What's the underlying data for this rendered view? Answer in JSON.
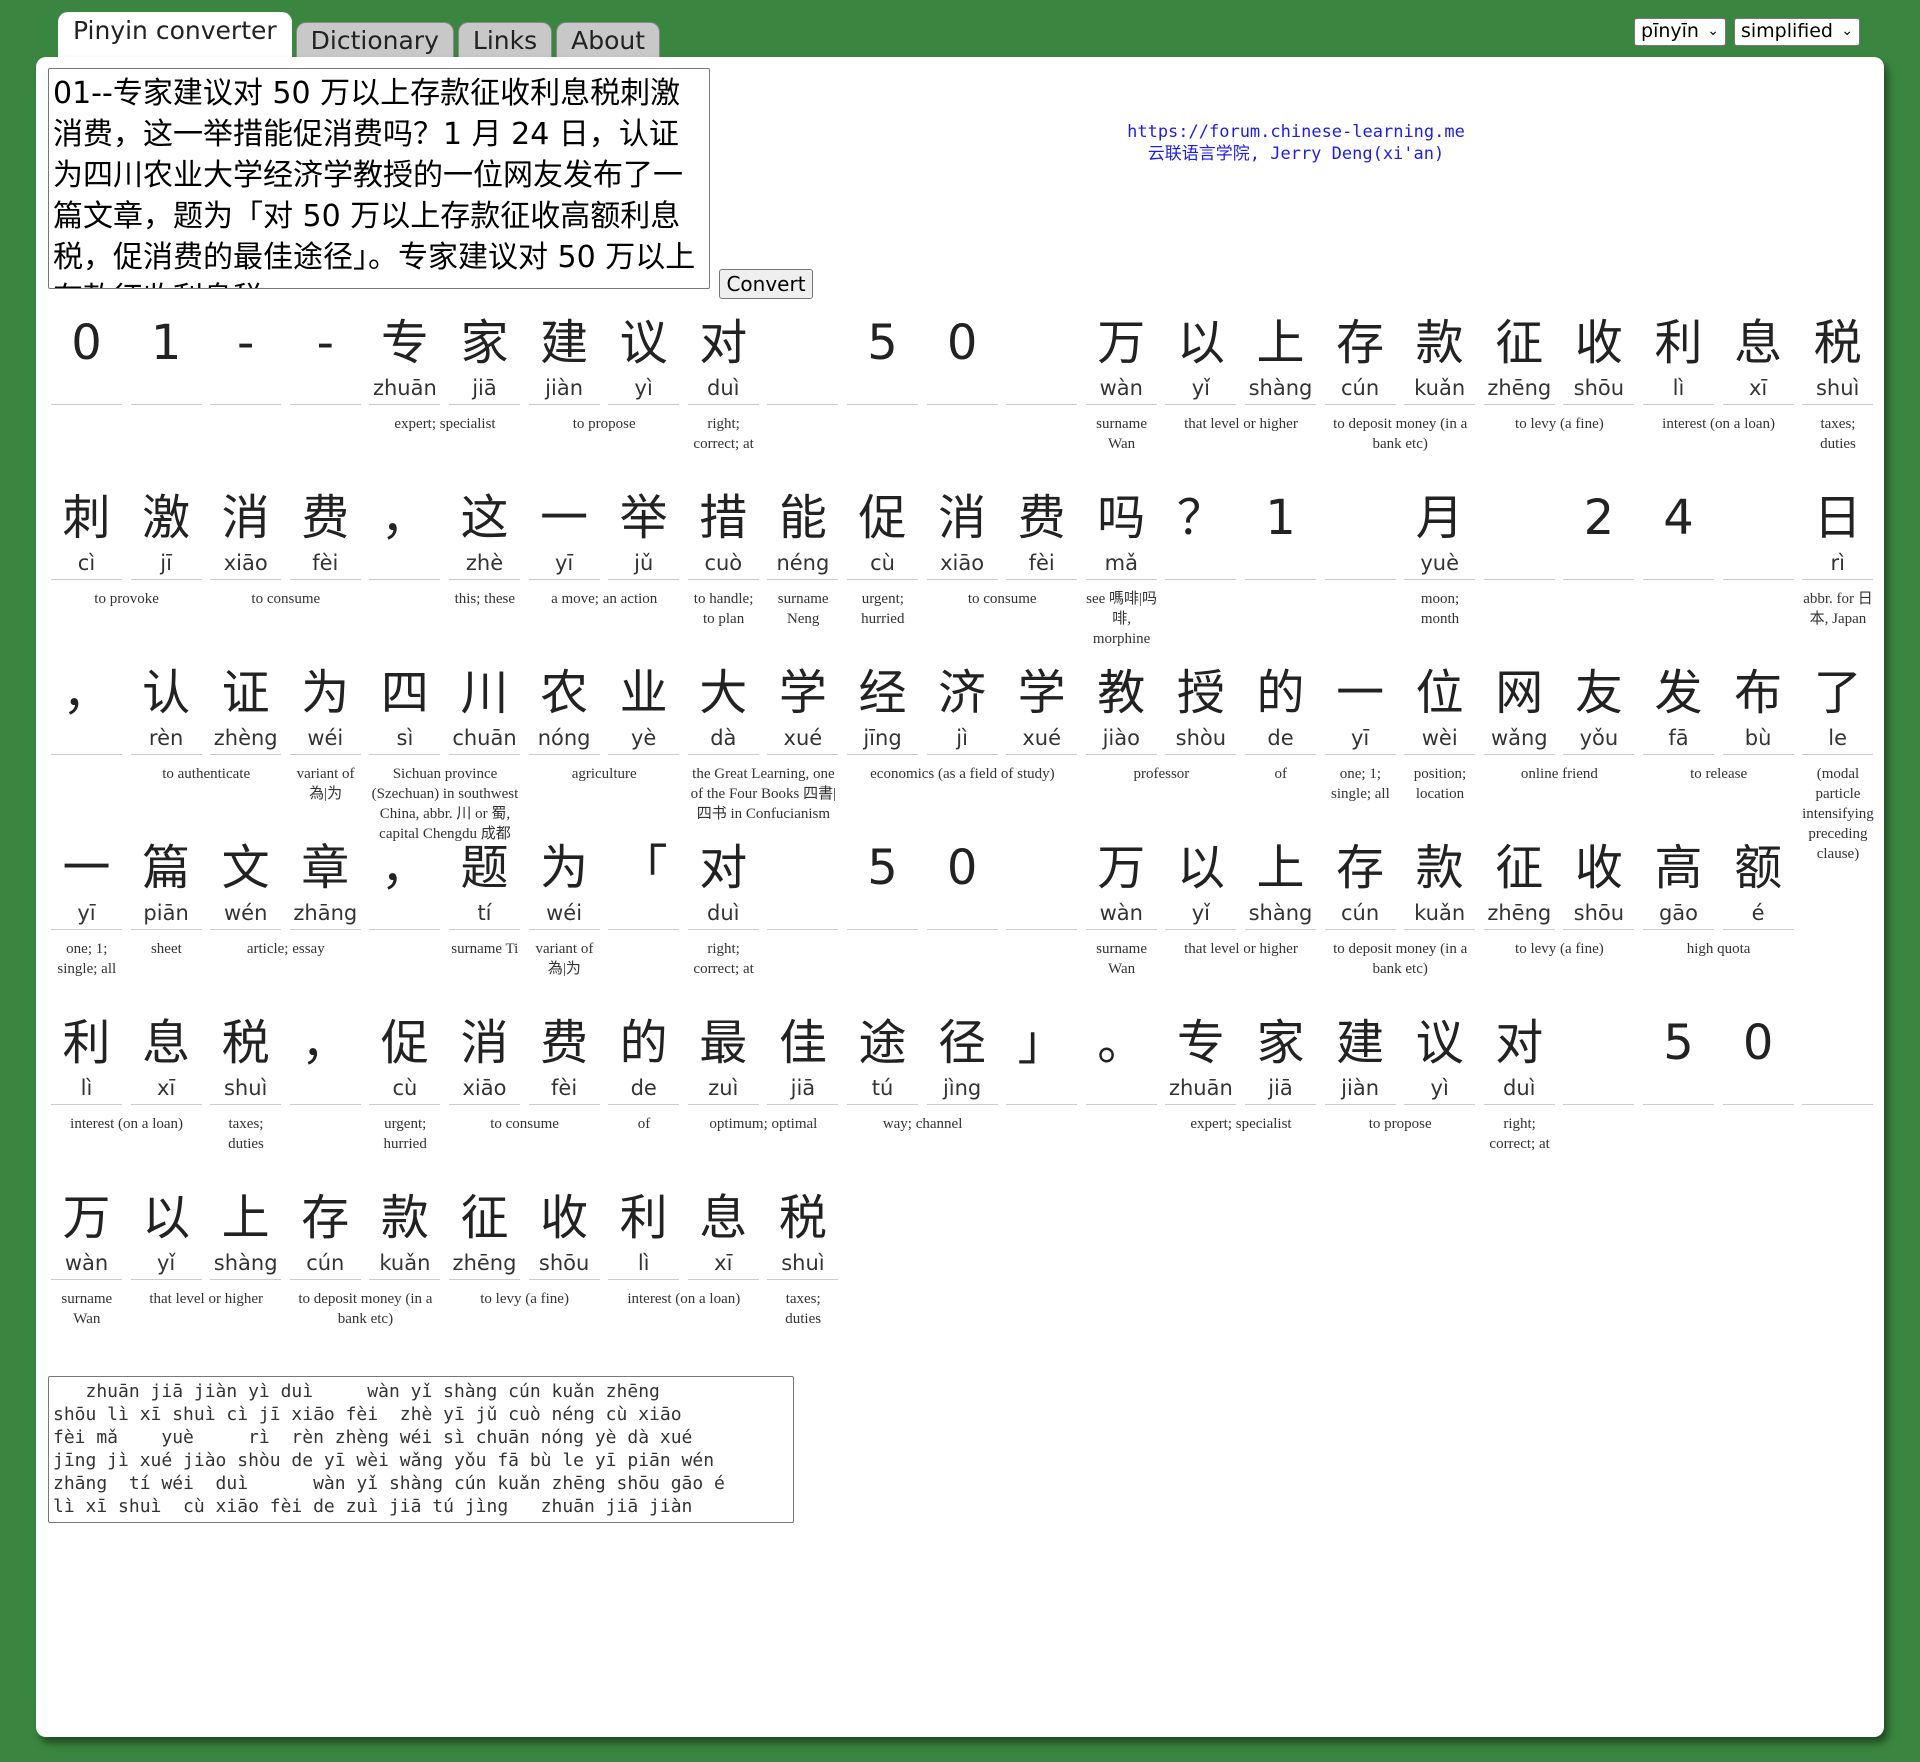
{
  "tabs": [
    "Pinyin converter",
    "Dictionary",
    "Links",
    "About"
  ],
  "selects": {
    "romanization": "pīnyīn",
    "script": "simplified"
  },
  "input_text": "01--专家建议对 50 万以上存款征收利息税刺激消费，这一举措能促消费吗？1 月 24 日，认证为四川农业大学经济学教授的一位网友发布了一篇文章，题为「对 50 万以上存款征收高额利息税，促消费的最佳途径」。专家建议对 50 万以上存款征收利息税",
  "convert_label": "Convert",
  "credit": {
    "url": "https://forum.chinese-learning.me",
    "name": "云联语言学院, Jerry Deng(xi'an)"
  },
  "rows": [
    {
      "cells": [
        [
          "0",
          ""
        ],
        [
          "1",
          ""
        ],
        [
          "-",
          ""
        ],
        [
          "-",
          ""
        ],
        [
          "专",
          "zhuān"
        ],
        [
          "家",
          "jiā"
        ],
        [
          "建",
          "jiàn"
        ],
        [
          "议",
          "yì"
        ],
        [
          "对",
          "duì"
        ],
        [
          "",
          ""
        ],
        [
          "5",
          ""
        ],
        [
          "0",
          ""
        ],
        [
          "",
          ""
        ],
        [
          "万",
          "wàn"
        ],
        [
          "以",
          "yǐ"
        ],
        [
          "上",
          "shàng"
        ],
        [
          "存",
          "cún"
        ],
        [
          "款",
          "kuǎn"
        ],
        [
          "征",
          "zhēng"
        ],
        [
          "收",
          "shōu"
        ],
        [
          "利",
          "lì"
        ],
        [
          "息",
          "xī"
        ],
        [
          "税",
          "shuì"
        ]
      ],
      "defs": [
        {
          "s": 4,
          "n": 2,
          "t": "expert; specialist"
        },
        {
          "s": 6,
          "n": 2,
          "t": "to propose"
        },
        {
          "s": 8,
          "n": 1,
          "t": "right; correct; at"
        },
        {
          "s": 13,
          "n": 1,
          "t": "surname Wan"
        },
        {
          "s": 14,
          "n": 2,
          "t": "that level or higher"
        },
        {
          "s": 16,
          "n": 2,
          "t": "to deposit money (in a bank etc)"
        },
        {
          "s": 18,
          "n": 2,
          "t": "to levy (a fine)"
        },
        {
          "s": 20,
          "n": 2,
          "t": "interest (on a loan)"
        },
        {
          "s": 22,
          "n": 1,
          "t": "taxes; duties"
        }
      ]
    },
    {
      "cells": [
        [
          "刺",
          "cì"
        ],
        [
          "激",
          "jī"
        ],
        [
          "消",
          "xiāo"
        ],
        [
          "费",
          "fèi"
        ],
        [
          "，",
          ""
        ],
        [
          "这",
          "zhè"
        ],
        [
          "一",
          "yī"
        ],
        [
          "举",
          "jǔ"
        ],
        [
          "措",
          "cuò"
        ],
        [
          "能",
          "néng"
        ],
        [
          "促",
          "cù"
        ],
        [
          "消",
          "xiāo"
        ],
        [
          "费",
          "fèi"
        ],
        [
          "吗",
          "mǎ"
        ],
        [
          "？",
          ""
        ],
        [
          "1",
          ""
        ],
        [
          "",
          ""
        ],
        [
          "月",
          "yuè"
        ],
        [
          "",
          ""
        ],
        [
          "2",
          ""
        ],
        [
          "4",
          ""
        ],
        [
          "",
          ""
        ],
        [
          "日",
          "rì"
        ]
      ],
      "defs": [
        {
          "s": 0,
          "n": 2,
          "t": "to provoke"
        },
        {
          "s": 2,
          "n": 2,
          "t": "to consume"
        },
        {
          "s": 5,
          "n": 1,
          "t": "this; these"
        },
        {
          "s": 6,
          "n": 2,
          "t": "a move; an action"
        },
        {
          "s": 8,
          "n": 1,
          "t": "to handle; to plan"
        },
        {
          "s": 9,
          "n": 1,
          "t": "surname Neng"
        },
        {
          "s": 10,
          "n": 1,
          "t": "urgent; hurried"
        },
        {
          "s": 11,
          "n": 2,
          "t": "to consume"
        },
        {
          "s": 13,
          "n": 1,
          "t": "see 嗎啡|吗啡, morphine"
        },
        {
          "s": 17,
          "n": 1,
          "t": "moon; month"
        },
        {
          "s": 22,
          "n": 1,
          "t": "abbr. for 日本, Japan"
        }
      ]
    },
    {
      "cells": [
        [
          "，",
          ""
        ],
        [
          "认",
          "rèn"
        ],
        [
          "证",
          "zhèng"
        ],
        [
          "为",
          "wéi"
        ],
        [
          "四",
          "sì"
        ],
        [
          "川",
          "chuān"
        ],
        [
          "农",
          "nóng"
        ],
        [
          "业",
          "yè"
        ],
        [
          "大",
          "dà"
        ],
        [
          "学",
          "xué"
        ],
        [
          "经",
          "jīng"
        ],
        [
          "济",
          "jì"
        ],
        [
          "学",
          "xué"
        ],
        [
          "教",
          "jiào"
        ],
        [
          "授",
          "shòu"
        ],
        [
          "的",
          "de"
        ],
        [
          "一",
          "yī"
        ],
        [
          "位",
          "wèi"
        ],
        [
          "网",
          "wǎng"
        ],
        [
          "友",
          "yǒu"
        ],
        [
          "发",
          "fā"
        ],
        [
          "布",
          "bù"
        ],
        [
          "了",
          "le"
        ]
      ],
      "defs": [
        {
          "s": 1,
          "n": 2,
          "t": "to authenticate"
        },
        {
          "s": 3,
          "n": 1,
          "t": "variant of 為|为"
        },
        {
          "s": 4,
          "n": 2,
          "t": "Sichuan province (Szechuan) in southwest China, abbr. 川 or 蜀, capital Chengdu 成都"
        },
        {
          "s": 6,
          "n": 2,
          "t": "agriculture"
        },
        {
          "s": 8,
          "n": 2,
          "t": "the Great Learning, one of the Four Books 四書|四书 in Confucianism"
        },
        {
          "s": 10,
          "n": 3,
          "t": "economics (as a field of study)"
        },
        {
          "s": 13,
          "n": 2,
          "t": "professor"
        },
        {
          "s": 15,
          "n": 1,
          "t": "of"
        },
        {
          "s": 16,
          "n": 1,
          "t": "one; 1; single; all"
        },
        {
          "s": 17,
          "n": 1,
          "t": "position; location"
        },
        {
          "s": 18,
          "n": 2,
          "t": "online friend"
        },
        {
          "s": 20,
          "n": 2,
          "t": "to release"
        },
        {
          "s": 22,
          "n": 1,
          "t": "(modal particle intensifying preceding clause)"
        }
      ]
    },
    {
      "cells": [
        [
          "一",
          "yī"
        ],
        [
          "篇",
          "piān"
        ],
        [
          "文",
          "wén"
        ],
        [
          "章",
          "zhāng"
        ],
        [
          "，",
          ""
        ],
        [
          "题",
          "tí"
        ],
        [
          "为",
          "wéi"
        ],
        [
          "「",
          ""
        ],
        [
          "对",
          "duì"
        ],
        [
          "",
          ""
        ],
        [
          "5",
          ""
        ],
        [
          "0",
          ""
        ],
        [
          "",
          ""
        ],
        [
          "万",
          "wàn"
        ],
        [
          "以",
          "yǐ"
        ],
        [
          "上",
          "shàng"
        ],
        [
          "存",
          "cún"
        ],
        [
          "款",
          "kuǎn"
        ],
        [
          "征",
          "zhēng"
        ],
        [
          "收",
          "shōu"
        ],
        [
          "高",
          "gāo"
        ],
        [
          "额",
          "é"
        ]
      ],
      "defs": [
        {
          "s": 0,
          "n": 1,
          "t": "one; 1; single; all"
        },
        {
          "s": 1,
          "n": 1,
          "t": "sheet"
        },
        {
          "s": 2,
          "n": 2,
          "t": "article; essay"
        },
        {
          "s": 5,
          "n": 1,
          "t": "surname Ti"
        },
        {
          "s": 6,
          "n": 1,
          "t": "variant of 為|为"
        },
        {
          "s": 8,
          "n": 1,
          "t": "right; correct; at"
        },
        {
          "s": 13,
          "n": 1,
          "t": "surname Wan"
        },
        {
          "s": 14,
          "n": 2,
          "t": "that level or higher"
        },
        {
          "s": 16,
          "n": 2,
          "t": "to deposit money (in a bank etc)"
        },
        {
          "s": 18,
          "n": 2,
          "t": "to levy (a fine)"
        },
        {
          "s": 20,
          "n": 2,
          "t": "high quota"
        }
      ]
    },
    {
      "cells": [
        [
          "利",
          "lì"
        ],
        [
          "息",
          "xī"
        ],
        [
          "税",
          "shuì"
        ],
        [
          "，",
          ""
        ],
        [
          "促",
          "cù"
        ],
        [
          "消",
          "xiāo"
        ],
        [
          "费",
          "fèi"
        ],
        [
          "的",
          "de"
        ],
        [
          "最",
          "zuì"
        ],
        [
          "佳",
          "jiā"
        ],
        [
          "途",
          "tú"
        ],
        [
          "径",
          "jìng"
        ],
        [
          "」",
          ""
        ],
        [
          "。",
          ""
        ],
        [
          "专",
          "zhuān"
        ],
        [
          "家",
          "jiā"
        ],
        [
          "建",
          "jiàn"
        ],
        [
          "议",
          "yì"
        ],
        [
          "对",
          "duì"
        ],
        [
          "",
          ""
        ],
        [
          "5",
          ""
        ],
        [
          "0",
          ""
        ],
        [
          "",
          ""
        ]
      ],
      "defs": [
        {
          "s": 0,
          "n": 2,
          "t": "interest (on a loan)"
        },
        {
          "s": 2,
          "n": 1,
          "t": "taxes; duties"
        },
        {
          "s": 4,
          "n": 1,
          "t": "urgent; hurried"
        },
        {
          "s": 5,
          "n": 2,
          "t": "to consume"
        },
        {
          "s": 7,
          "n": 1,
          "t": "of"
        },
        {
          "s": 8,
          "n": 2,
          "t": "optimum; optimal"
        },
        {
          "s": 10,
          "n": 2,
          "t": "way; channel"
        },
        {
          "s": 14,
          "n": 2,
          "t": "expert; specialist"
        },
        {
          "s": 16,
          "n": 2,
          "t": "to propose"
        },
        {
          "s": 18,
          "n": 1,
          "t": "right; correct; at"
        }
      ]
    },
    {
      "cells": [
        [
          "万",
          "wàn"
        ],
        [
          "以",
          "yǐ"
        ],
        [
          "上",
          "shàng"
        ],
        [
          "存",
          "cún"
        ],
        [
          "款",
          "kuǎn"
        ],
        [
          "征",
          "zhēng"
        ],
        [
          "收",
          "shōu"
        ],
        [
          "利",
          "lì"
        ],
        [
          "息",
          "xī"
        ],
        [
          "税",
          "shuì"
        ]
      ],
      "defs": [
        {
          "s": 0,
          "n": 1,
          "t": "surname Wan"
        },
        {
          "s": 1,
          "n": 2,
          "t": "that level or higher"
        },
        {
          "s": 3,
          "n": 2,
          "t": "to deposit money (in a bank etc)"
        },
        {
          "s": 5,
          "n": 2,
          "t": "to levy (a fine)"
        },
        {
          "s": 7,
          "n": 2,
          "t": "interest (on a loan)"
        },
        {
          "s": 9,
          "n": 1,
          "t": "taxes; duties"
        }
      ]
    }
  ],
  "output_text": "   zhuān jiā jiàn yì duì     wàn yǐ shàng cún kuǎn zhēng\nshōu lì xī shuì cì jī xiāo fèi  zhè yī jǔ cuò néng cù xiāo\nfèi mǎ    yuè     rì  rèn zhèng wéi sì chuān nóng yè dà xué\njīng jì xué jiào shòu de yī wèi wǎng yǒu fā bù le yī piān wén\nzhāng  tí wéi  duì      wàn yǐ shàng cún kuǎn zhēng shōu gāo é\nlì xī shuì  cù xiāo fèi de zuì jiā tú jìng   zhuān jiā jiàn"
}
